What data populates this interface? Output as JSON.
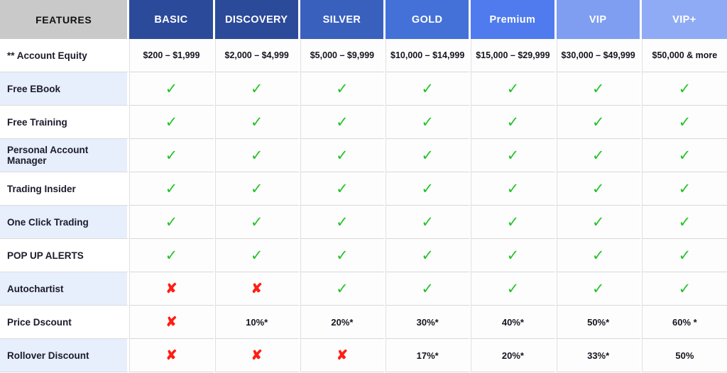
{
  "table": {
    "feature_column_header": "FEATURES",
    "plans": [
      {
        "label": "BASIC",
        "color": "#2c4a9a"
      },
      {
        "label": "DISCOVERY",
        "color": "#2c4a9a"
      },
      {
        "label": "SILVER",
        "color": "#3a60bd"
      },
      {
        "label": "GOLD",
        "color": "#4471d8"
      },
      {
        "label": "Premium",
        "color": "#4f7bee"
      },
      {
        "label": "VIP",
        "color": "#7f9ef2"
      },
      {
        "label": "VIP+",
        "color": "#8fabf5"
      }
    ],
    "marks": {
      "yes_glyph": "✓",
      "no_glyph": "✘",
      "yes_color": "#25c328",
      "no_color": "#ff1e14",
      "yes_name": "check-icon",
      "no_name": "cross-icon"
    },
    "rows": [
      {
        "feature": "** Account Equity",
        "type": "text",
        "values": [
          "$200 – $1,999",
          "$2,000 – $4,999",
          "$5,000 – $9,999",
          "$10,000 – $14,999",
          "$15,000 – $29,999",
          "$30,000 – $49,999",
          "$50,000 & more"
        ]
      },
      {
        "feature": "Free EBook",
        "type": "mark",
        "values": [
          "yes",
          "yes",
          "yes",
          "yes",
          "yes",
          "yes",
          "yes"
        ]
      },
      {
        "feature": "Free Training",
        "type": "mark",
        "values": [
          "yes",
          "yes",
          "yes",
          "yes",
          "yes",
          "yes",
          "yes"
        ]
      },
      {
        "feature": "Personal Account Manager",
        "type": "mark",
        "values": [
          "yes",
          "yes",
          "yes",
          "yes",
          "yes",
          "yes",
          "yes"
        ]
      },
      {
        "feature": "Trading Insider",
        "type": "mark",
        "values": [
          "yes",
          "yes",
          "yes",
          "yes",
          "yes",
          "yes",
          "yes"
        ]
      },
      {
        "feature": "One Click Trading",
        "type": "mark",
        "values": [
          "yes",
          "yes",
          "yes",
          "yes",
          "yes",
          "yes",
          "yes"
        ]
      },
      {
        "feature": "POP UP ALERTS",
        "type": "mark",
        "values": [
          "yes",
          "yes",
          "yes",
          "yes",
          "yes",
          "yes",
          "yes"
        ]
      },
      {
        "feature": "Autochartist",
        "type": "mark",
        "values": [
          "no",
          "no",
          "yes",
          "yes",
          "yes",
          "yes",
          "yes"
        ]
      },
      {
        "feature": "Price Dscount",
        "type": "mixed",
        "values": [
          "no",
          "10%*",
          "20%*",
          "30%*",
          "40%*",
          "50%*",
          "60% *"
        ]
      },
      {
        "feature": "Rollover Discount",
        "type": "mixed",
        "values": [
          "no",
          "no",
          "no",
          "17%*",
          "20%*",
          "33%*",
          "50%"
        ]
      }
    ]
  }
}
